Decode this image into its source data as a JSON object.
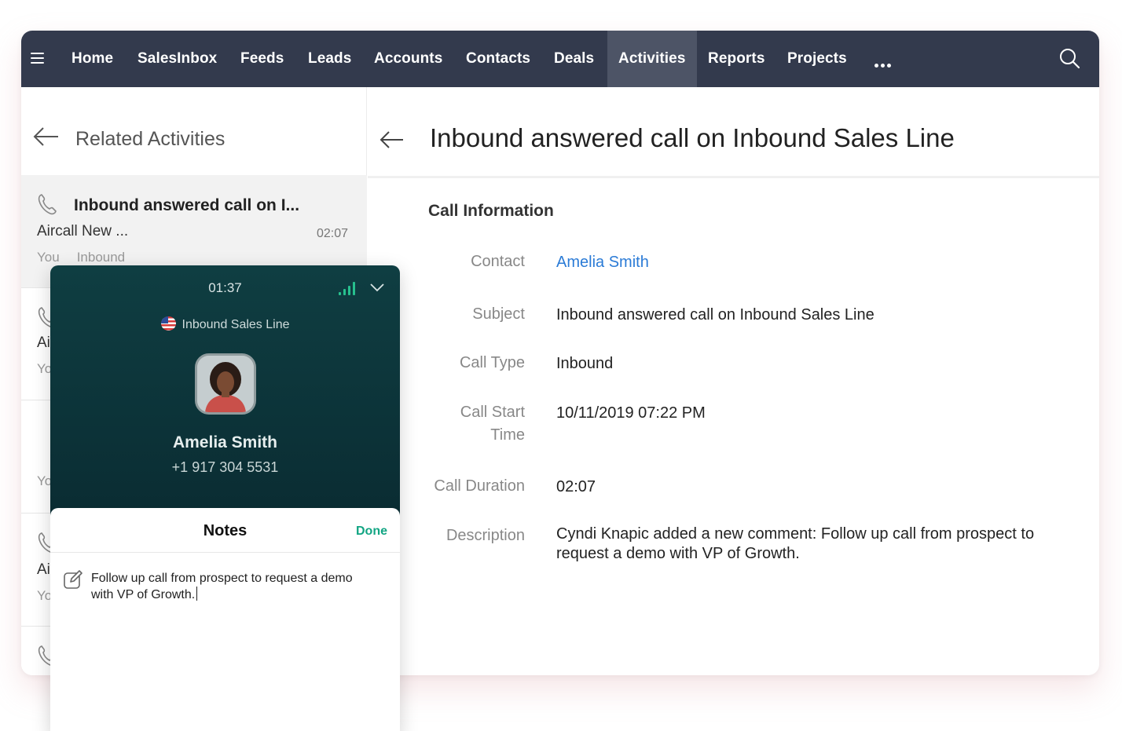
{
  "nav": {
    "items": [
      "Home",
      "SalesInbox",
      "Feeds",
      "Leads",
      "Accounts",
      "Contacts",
      "Deals",
      "Activities",
      "Reports",
      "Projects"
    ],
    "active": "Activities",
    "bg_color": "#333a4d",
    "active_color": "#4d5466"
  },
  "left_panel": {
    "title": "Related Activities",
    "items": [
      {
        "subject": "Inbound answered call on I...",
        "related": "Aircall New ...",
        "duration": "02:07",
        "owner": "You",
        "type": "Inbound"
      },
      {
        "related": "Ai",
        "owner": "Yo"
      },
      {
        "related": "",
        "owner": "Yo"
      },
      {
        "related": "Ai",
        "owner": "Yo"
      }
    ]
  },
  "detail": {
    "title": "Inbound answered call on Inbound Sales Line",
    "section": "Call Information",
    "fields": {
      "contact": {
        "label": "Contact",
        "value": "Amelia Smith"
      },
      "subject": {
        "label": "Subject",
        "value": "Inbound answered call on Inbound Sales Line"
      },
      "call_type": {
        "label": "Call Type",
        "value": "Inbound"
      },
      "call_start": {
        "label_1": "Call Start",
        "label_2": "Time",
        "value": "10/11/2019 07:22 PM"
      },
      "call_duration": {
        "label": "Call Duration",
        "value": "02:07"
      },
      "description": {
        "label": "Description",
        "value_1": "Cyndi Knapic added a new comment: Follow up call from prospect to",
        "value_2": "request a demo with VP of Growth."
      }
    },
    "link_color": "#2b7bd6"
  },
  "aircall": {
    "timer": "01:37",
    "line": "Inbound Sales Line",
    "caller_name": "Amelia Smith",
    "caller_number": "+1 917 304 5531",
    "notes": {
      "title": "Notes",
      "done": "Done",
      "text_1": "Follow up call from prospect to request a demo",
      "text_2": "with VP of Growth."
    },
    "accent_color": "#12a583"
  }
}
